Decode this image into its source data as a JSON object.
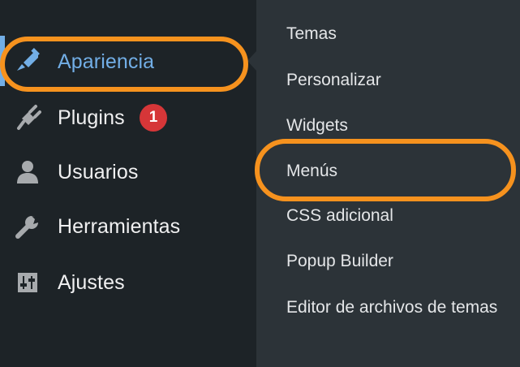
{
  "sidebar": {
    "items": [
      {
        "label": "Apariencia",
        "icon": "paintbrush-icon",
        "active": true
      },
      {
        "label": "Plugins",
        "icon": "plug-icon",
        "badge": "1"
      },
      {
        "label": "Usuarios",
        "icon": "user-icon"
      },
      {
        "label": "Herramientas",
        "icon": "wrench-icon"
      },
      {
        "label": "Ajustes",
        "icon": "sliders-icon"
      }
    ]
  },
  "submenu": {
    "items": [
      {
        "label": "Temas"
      },
      {
        "label": "Personalizar"
      },
      {
        "label": "Widgets"
      },
      {
        "label": "Menús",
        "highlighted": true
      },
      {
        "label": "CSS adicional"
      },
      {
        "label": "Popup Builder"
      },
      {
        "label": "Editor de archivos de temas"
      }
    ]
  },
  "colors": {
    "sidebar_bg": "#1d2327",
    "submenu_bg": "#2c3338",
    "active_text": "#72aee6",
    "highlight": "#f6921e",
    "badge": "#d63638"
  }
}
